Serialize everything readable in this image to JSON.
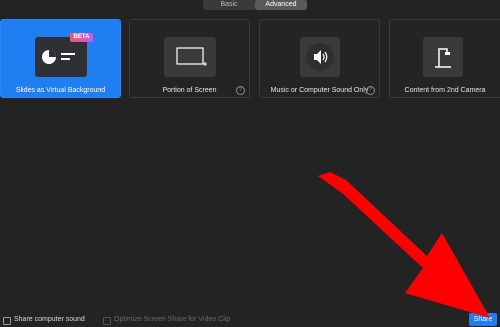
{
  "tabs": [
    {
      "label": "Basic",
      "active": false
    },
    {
      "label": "Advanced",
      "active": true
    }
  ],
  "options": [
    {
      "label": "Slides as Virtual Background",
      "icon": "slides-virtual-background-icon",
      "badge": "BETA",
      "selected": true
    },
    {
      "label": "Portion of Screen",
      "icon": "screen-portion-icon",
      "help": "?",
      "selected": false
    },
    {
      "label": "Music or Computer Sound Only",
      "icon": "speaker-icon",
      "help": "?",
      "selected": false
    },
    {
      "label": "Content from 2nd Camera",
      "icon": "document-camera-icon",
      "selected": false
    }
  ],
  "bottom": {
    "share_sound_label": "Share computer sound",
    "optimize_label": "Optimize Screen Share for Video Clip",
    "share_button": "Share"
  },
  "colors": {
    "accent": "#1f7ef0",
    "background": "#232323",
    "annotation_arrow": "#ff0000"
  }
}
